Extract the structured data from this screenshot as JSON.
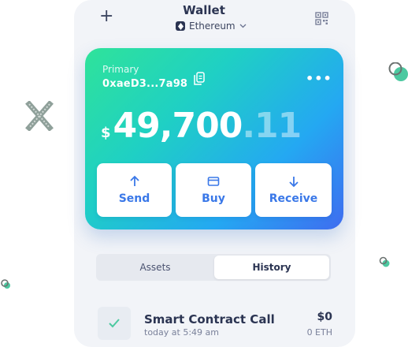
{
  "header": {
    "title": "Wallet",
    "network": "Ethereum",
    "add_icon": "plus-icon",
    "qr_icon": "qr-code-icon"
  },
  "card": {
    "label": "Primary",
    "address": "0xaeD3...7a98",
    "currency_symbol": "$",
    "balance_integer": "49,700",
    "balance_decimal": ".11",
    "gradient": [
      "#2fe39a",
      "#1fd0c4",
      "#24a8f2",
      "#3f6cf0"
    ],
    "actions": [
      {
        "label": "Send",
        "icon": "arrow-up-icon"
      },
      {
        "label": "Buy",
        "icon": "card-icon"
      },
      {
        "label": "Receive",
        "icon": "arrow-down-icon"
      }
    ]
  },
  "tabs": {
    "assets": "Assets",
    "history": "History",
    "active": "History"
  },
  "transactions": [
    {
      "title": "Smart Contract Call",
      "time": "today at 5:49 am",
      "amount": "$0",
      "amount_eth": "0 ETH",
      "status_icon": "check-icon"
    }
  ],
  "colors": {
    "accent_blue": "#3a78e8",
    "text_dark": "#2b3452",
    "deco_green": "#4cc9a0"
  }
}
